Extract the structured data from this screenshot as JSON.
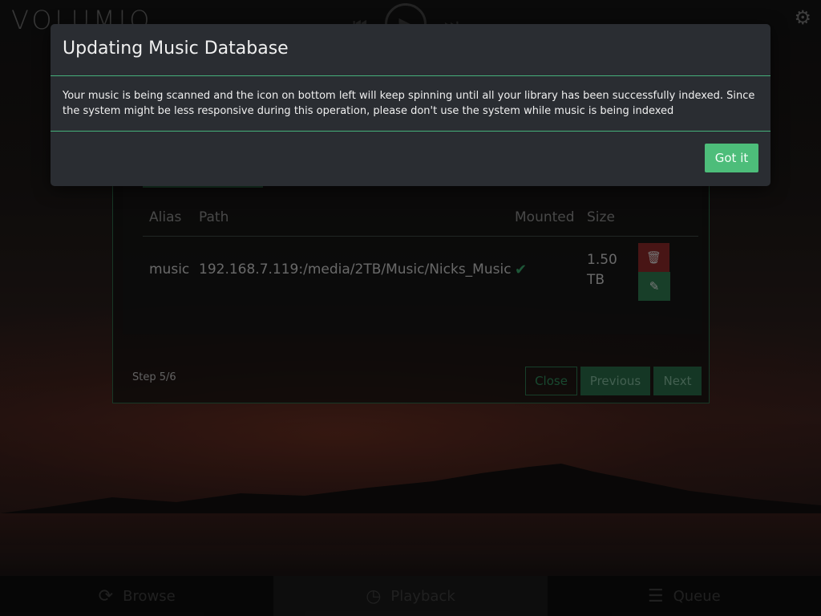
{
  "app": {
    "logo": "VOLUMIO"
  },
  "wizard": {
    "table": {
      "headers": [
        "Alias",
        "Path",
        "Mounted",
        "Size"
      ],
      "rows": [
        {
          "alias": "music",
          "path": "192.168.7.119:/media/2TB/Music/Nicks_Music",
          "mounted": true,
          "size_value": "1.50",
          "size_unit": "TB"
        }
      ]
    },
    "step_label": "Step 5/6",
    "buttons": {
      "close": "Close",
      "previous": "Previous",
      "next": "Next"
    }
  },
  "bottom_nav": {
    "items": [
      {
        "label": "Browse",
        "icon": "refresh-icon"
      },
      {
        "label": "Playback",
        "icon": "clock-icon"
      },
      {
        "label": "Queue",
        "icon": "list-icon"
      }
    ],
    "active": "Playback"
  },
  "modal": {
    "title": "Updating Music Database",
    "body": "Your music is being scanned and the icon on bottom left will keep spinning until all your library has been successfully indexed. Since the system might be less responsive during this operation, please don't use the system while music is being indexed",
    "confirm_label": "Got it"
  },
  "colors": {
    "accent": "#4dbd7a",
    "modal_bg": "#2a2d32",
    "delete": "#8a2a2a",
    "edit": "#2f7a50"
  }
}
